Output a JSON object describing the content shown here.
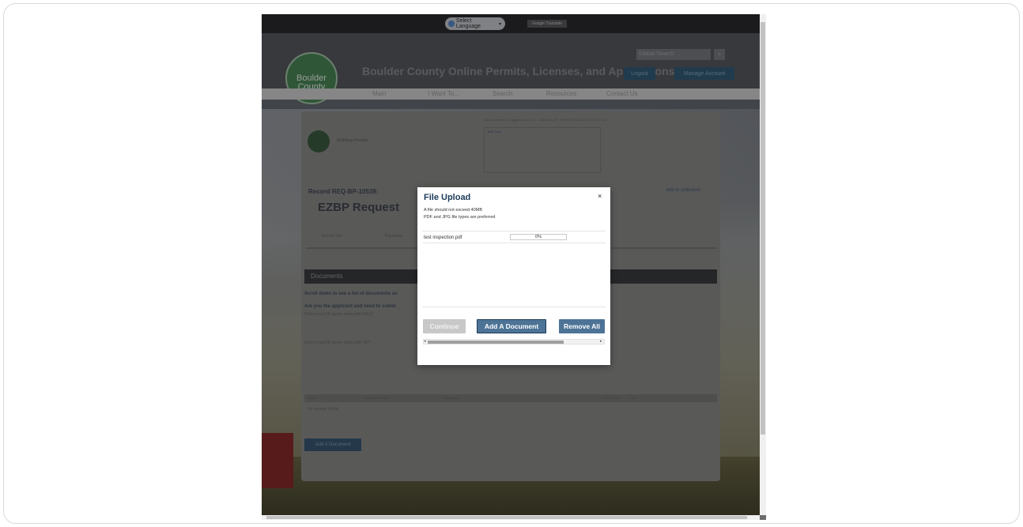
{
  "site": {
    "language_select": "Select Language",
    "translate_badge": "Google Translate",
    "logo_text": "Boulder County",
    "title": "Boulder County Online Permits, Licenses, and Applications",
    "global_search_placeholder": "Global Search",
    "logout": "Logout",
    "manage_account": "Manage Account",
    "nav": [
      "Main",
      "I Want To...",
      "Search",
      "Resources",
      "Contact Us"
    ]
  },
  "card": {
    "section_title": "Building Permits",
    "record_label": "Record REQ-BP-10539:",
    "record_type": "EZBP Request",
    "add_to_collection": "Add to collection",
    "tabs": [
      "Record Info",
      "Payments"
    ],
    "documents_header": "Documents",
    "scroll_text": "Scroll down to see a list of documents as",
    "applicant_q": "Are you the applicant and need to submi",
    "starts_req": "If the record ID above starts with \"REQ\"",
    "starts_bp": "If the record ID above starts with \"BP\"",
    "add_document": "Add A Document",
    "no_records": "No records found.",
    "table_headers": [
      "Name",
      "Document Status",
      "Description",
      "Upload Date",
      "Size"
    ],
    "top_links": [
      "Announcements",
      "Logged in as: Tom",
      "Collections (0)",
      "REPORTS AND STATISTICS (1)"
    ],
    "tess_label": "Tess Tess"
  },
  "modal": {
    "title": "File Upload",
    "close": "×",
    "note1": "A file should not exceed 40MB",
    "note2": "PDF and JPG file types are preferred",
    "file_name": "test inspection.pdf",
    "progress": "0%",
    "progress_value": 0,
    "buttons": {
      "continue": "Continue",
      "add": "Add A Document",
      "remove": "Remove All"
    }
  }
}
